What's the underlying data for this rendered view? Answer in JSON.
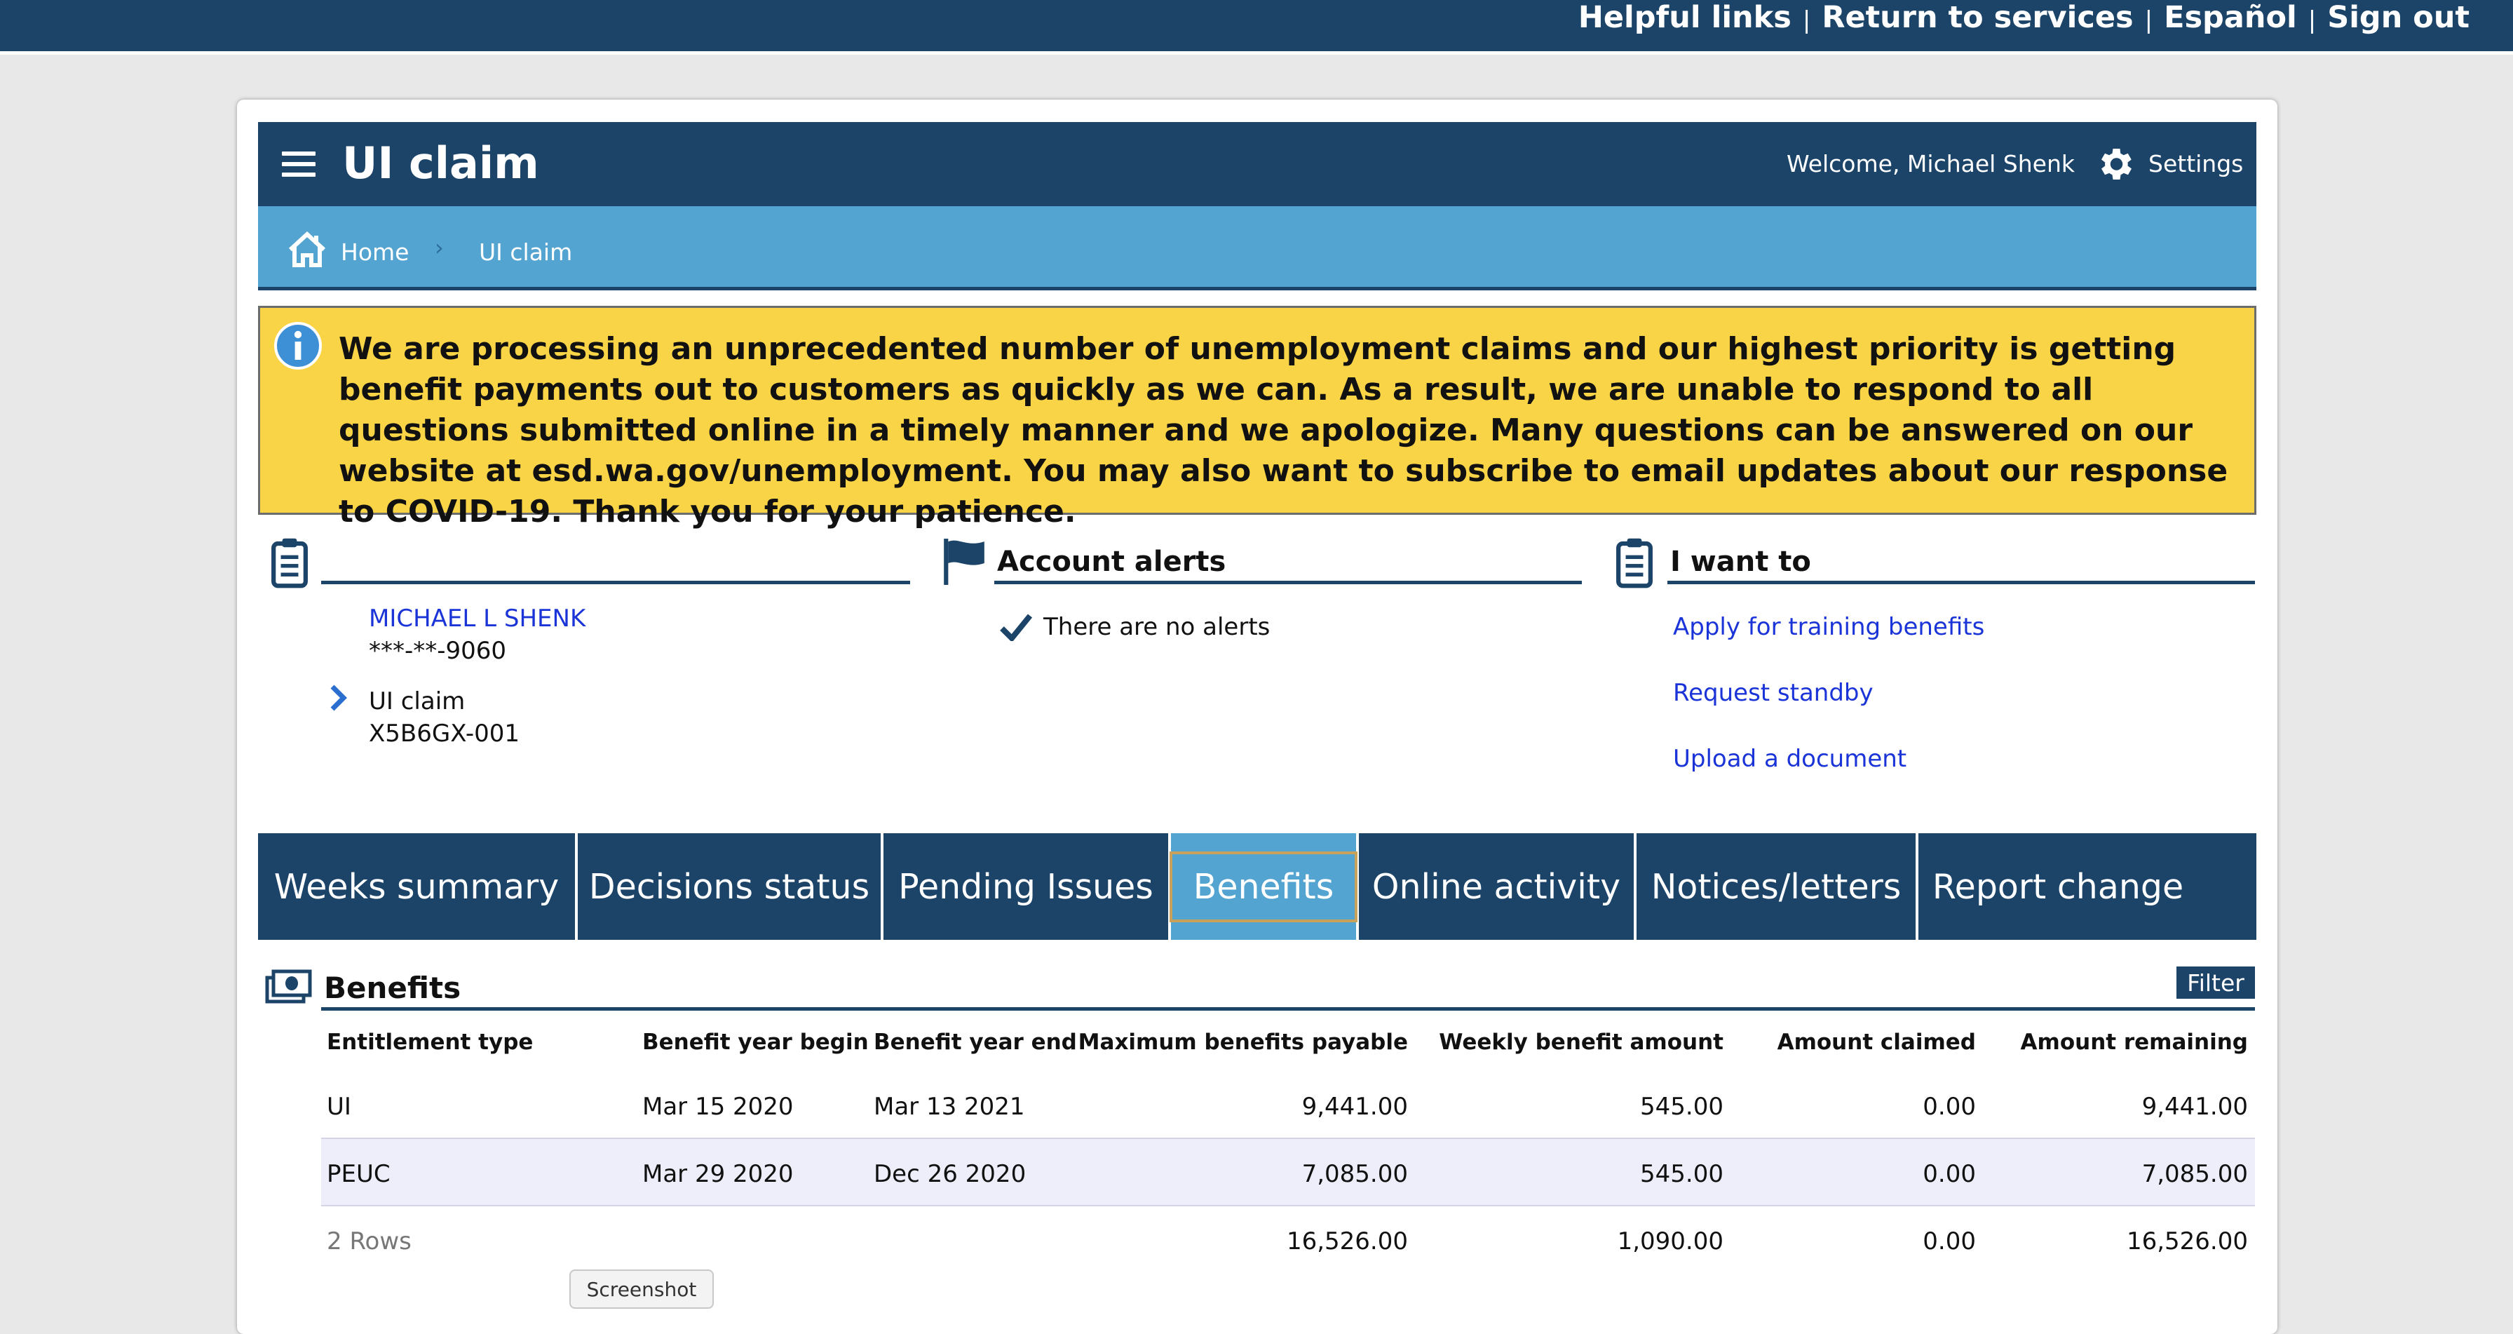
{
  "top_links": {
    "helpful": "Helpful links",
    "sep": "|",
    "return": "Return to services",
    "espanol": "Español",
    "signout": "Sign out"
  },
  "header": {
    "title": "UI claim",
    "welcome": "Welcome, Michael Shenk",
    "settings": "Settings"
  },
  "breadcrumb": {
    "home": "Home",
    "separator": "›",
    "current": "UI claim"
  },
  "notice": {
    "text": "We are processing an unprecedented number of unemployment claims and our highest priority is getting benefit payments out to customers as quickly as we can. As a result, we are unable to respond to all questions submitted online in a timely manner and we apologize. Many questions can be answered on our website at esd.wa.gov/unemployment. You may also want to subscribe to email updates about our response to COVID-19. Thank you for your patience."
  },
  "claimant": {
    "name": "MICHAEL L SHENK",
    "ssn": "***-**-9060",
    "claim_label": "UI claim",
    "claim_id": "X5B6GX-001"
  },
  "alerts": {
    "heading": "Account alerts",
    "message": "There are no alerts"
  },
  "iwant": {
    "heading": "I want to",
    "links": [
      "Apply for training benefits",
      "Request standby",
      "Upload a document"
    ]
  },
  "tabs": [
    "Weeks summary",
    "Decisions status",
    "Pending Issues",
    "Benefits",
    "Online activity",
    "Notices/letters",
    "Report change"
  ],
  "active_tab": "Benefits",
  "benefits": {
    "title": "Benefits",
    "filter": "Filter",
    "columns": [
      "Entitlement type",
      "Benefit year begin",
      "Benefit year end",
      "Maximum benefits payable",
      "Weekly benefit amount",
      "Amount claimed",
      "Amount remaining"
    ],
    "rows": [
      [
        "UI",
        "Mar 15 2020",
        "Mar 13 2021",
        "9,441.00",
        "545.00",
        "0.00",
        "9,441.00"
      ],
      [
        "PEUC",
        "Mar 29 2020",
        "Dec 26 2020",
        "7,085.00",
        "545.00",
        "0.00",
        "7,085.00"
      ]
    ],
    "footer": {
      "count": "2 Rows",
      "max": "16,526.00",
      "weekly": "1,090.00",
      "claimed": "0.00",
      "remaining": "16,526.00"
    }
  },
  "tooltip": "Screenshot",
  "colors": {
    "navy": "#1c4468",
    "light_blue": "#54a4d1",
    "notice_yellow": "#fad447",
    "link_blue": "#1a34d8",
    "row_highlight": "#eeeefb"
  }
}
